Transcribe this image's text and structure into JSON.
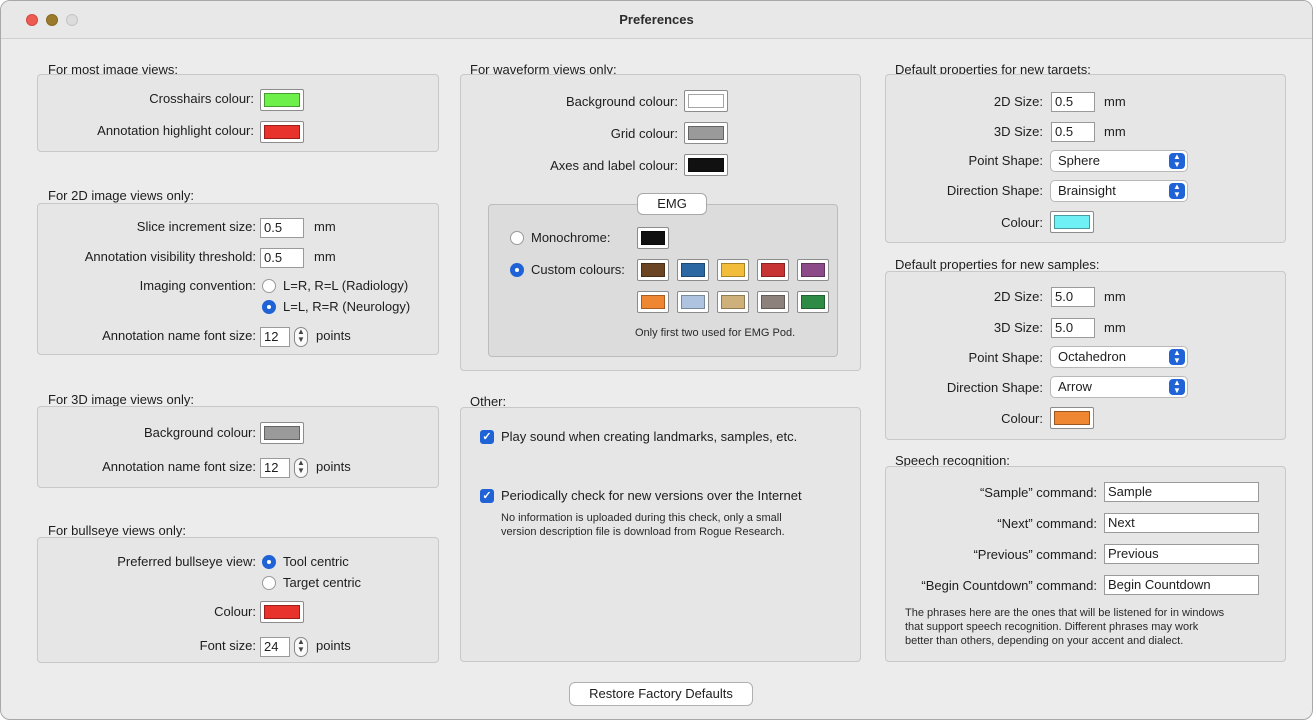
{
  "window": {
    "title": "Preferences"
  },
  "most": {
    "title": "For most image views:",
    "crosshairs_label": "Crosshairs colour:",
    "crosshairs_color": "#6ef04a",
    "annotation_label": "Annotation highlight colour:",
    "annotation_color": "#e8322c"
  },
  "view2d": {
    "title": "For 2D image views only:",
    "slice_label": "Slice increment size:",
    "slice_value": "0.5",
    "slice_unit": "mm",
    "vis_label": "Annotation visibility threshold:",
    "vis_value": "0.5",
    "vis_unit": "mm",
    "conv_label": "Imaging convention:",
    "conv_opt1": "L=R, R=L (Radiology)",
    "conv_opt2": "L=L, R=R (Neurology)",
    "conv_selected": "L=L, R=R (Neurology)",
    "font_label": "Annotation name font size:",
    "font_value": "12",
    "font_unit": "points"
  },
  "view3d": {
    "title": "For 3D image views only:",
    "bg_label": "Background colour:",
    "bg_color": "#9a9a9a",
    "font_label": "Annotation name font size:",
    "font_value": "12",
    "font_unit": "points"
  },
  "bullseye": {
    "title": "For bullseye views only:",
    "pref_label": "Preferred bullseye view:",
    "opt1": "Tool centric",
    "opt2": "Target centric",
    "selected": "Tool centric",
    "colour_label": "Colour:",
    "colour": "#e8322c",
    "font_label": "Font size:",
    "font_value": "24",
    "font_unit": "points"
  },
  "waveform": {
    "title": "For waveform views only:",
    "bg_label": "Background colour:",
    "bg_color": "#ffffff",
    "grid_label": "Grid colour:",
    "grid_color": "#9a9a9a",
    "axes_label": "Axes and label colour:",
    "axes_color": "#111111",
    "emg": {
      "title": "EMG",
      "mono_label": "Monochrome:",
      "mono_color": "#111111",
      "custom_label": "Custom colours:",
      "selected": "Custom colours:",
      "colors_row1": [
        "#6b4423",
        "#2a67a3",
        "#f3bd3c",
        "#c73232",
        "#8c4b88"
      ],
      "colors_row2": [
        "#ee8632",
        "#aec3df",
        "#cdb07a",
        "#8c827b",
        "#2e8b46"
      ],
      "note": "Only first two used for EMG Pod."
    }
  },
  "other": {
    "title": "Other:",
    "sound_label": "Play sound when creating landmarks, samples, etc.",
    "sound_checked": true,
    "update_label": "Periodically check for new versions over the Internet",
    "update_checked": true,
    "update_note_1": "No information is uploaded during this check, only a small",
    "update_note_2": "version description file is download from Rogue Research."
  },
  "targets": {
    "title": "Default properties for new targets:",
    "size2d_label": "2D Size:",
    "size2d_value": "0.5",
    "size2d_unit": "mm",
    "size3d_label": "3D Size:",
    "size3d_value": "0.5",
    "size3d_unit": "mm",
    "point_label": "Point Shape:",
    "point_value": "Sphere",
    "dir_label": "Direction Shape:",
    "dir_value": "Brainsight",
    "colour_label": "Colour:",
    "colour": "#6ff0f5"
  },
  "samples": {
    "title": "Default properties for new samples:",
    "size2d_label": "2D Size:",
    "size2d_value": "5.0",
    "size2d_unit": "mm",
    "size3d_label": "3D Size:",
    "size3d_value": "5.0",
    "size3d_unit": "mm",
    "point_label": "Point Shape:",
    "point_value": "Octahedron",
    "dir_label": "Direction Shape:",
    "dir_value": "Arrow",
    "colour_label": "Colour:",
    "colour": "#ee8632"
  },
  "speech": {
    "title": "Speech recognition:",
    "sample_label": "“Sample” command:",
    "sample_value": "Sample",
    "next_label": "“Next” command:",
    "next_value": "Next",
    "prev_label": "“Previous” command:",
    "prev_value": "Previous",
    "countdown_label": "“Begin Countdown” command:",
    "countdown_value": "Begin Countdown",
    "note_1": "The phrases here are the ones that will be listened for in windows",
    "note_2": "that support speech recognition. Different phrases may work",
    "note_3": "better than others, depending on your accent and dialect."
  },
  "footer": {
    "restore_label": "Restore Factory Defaults"
  }
}
